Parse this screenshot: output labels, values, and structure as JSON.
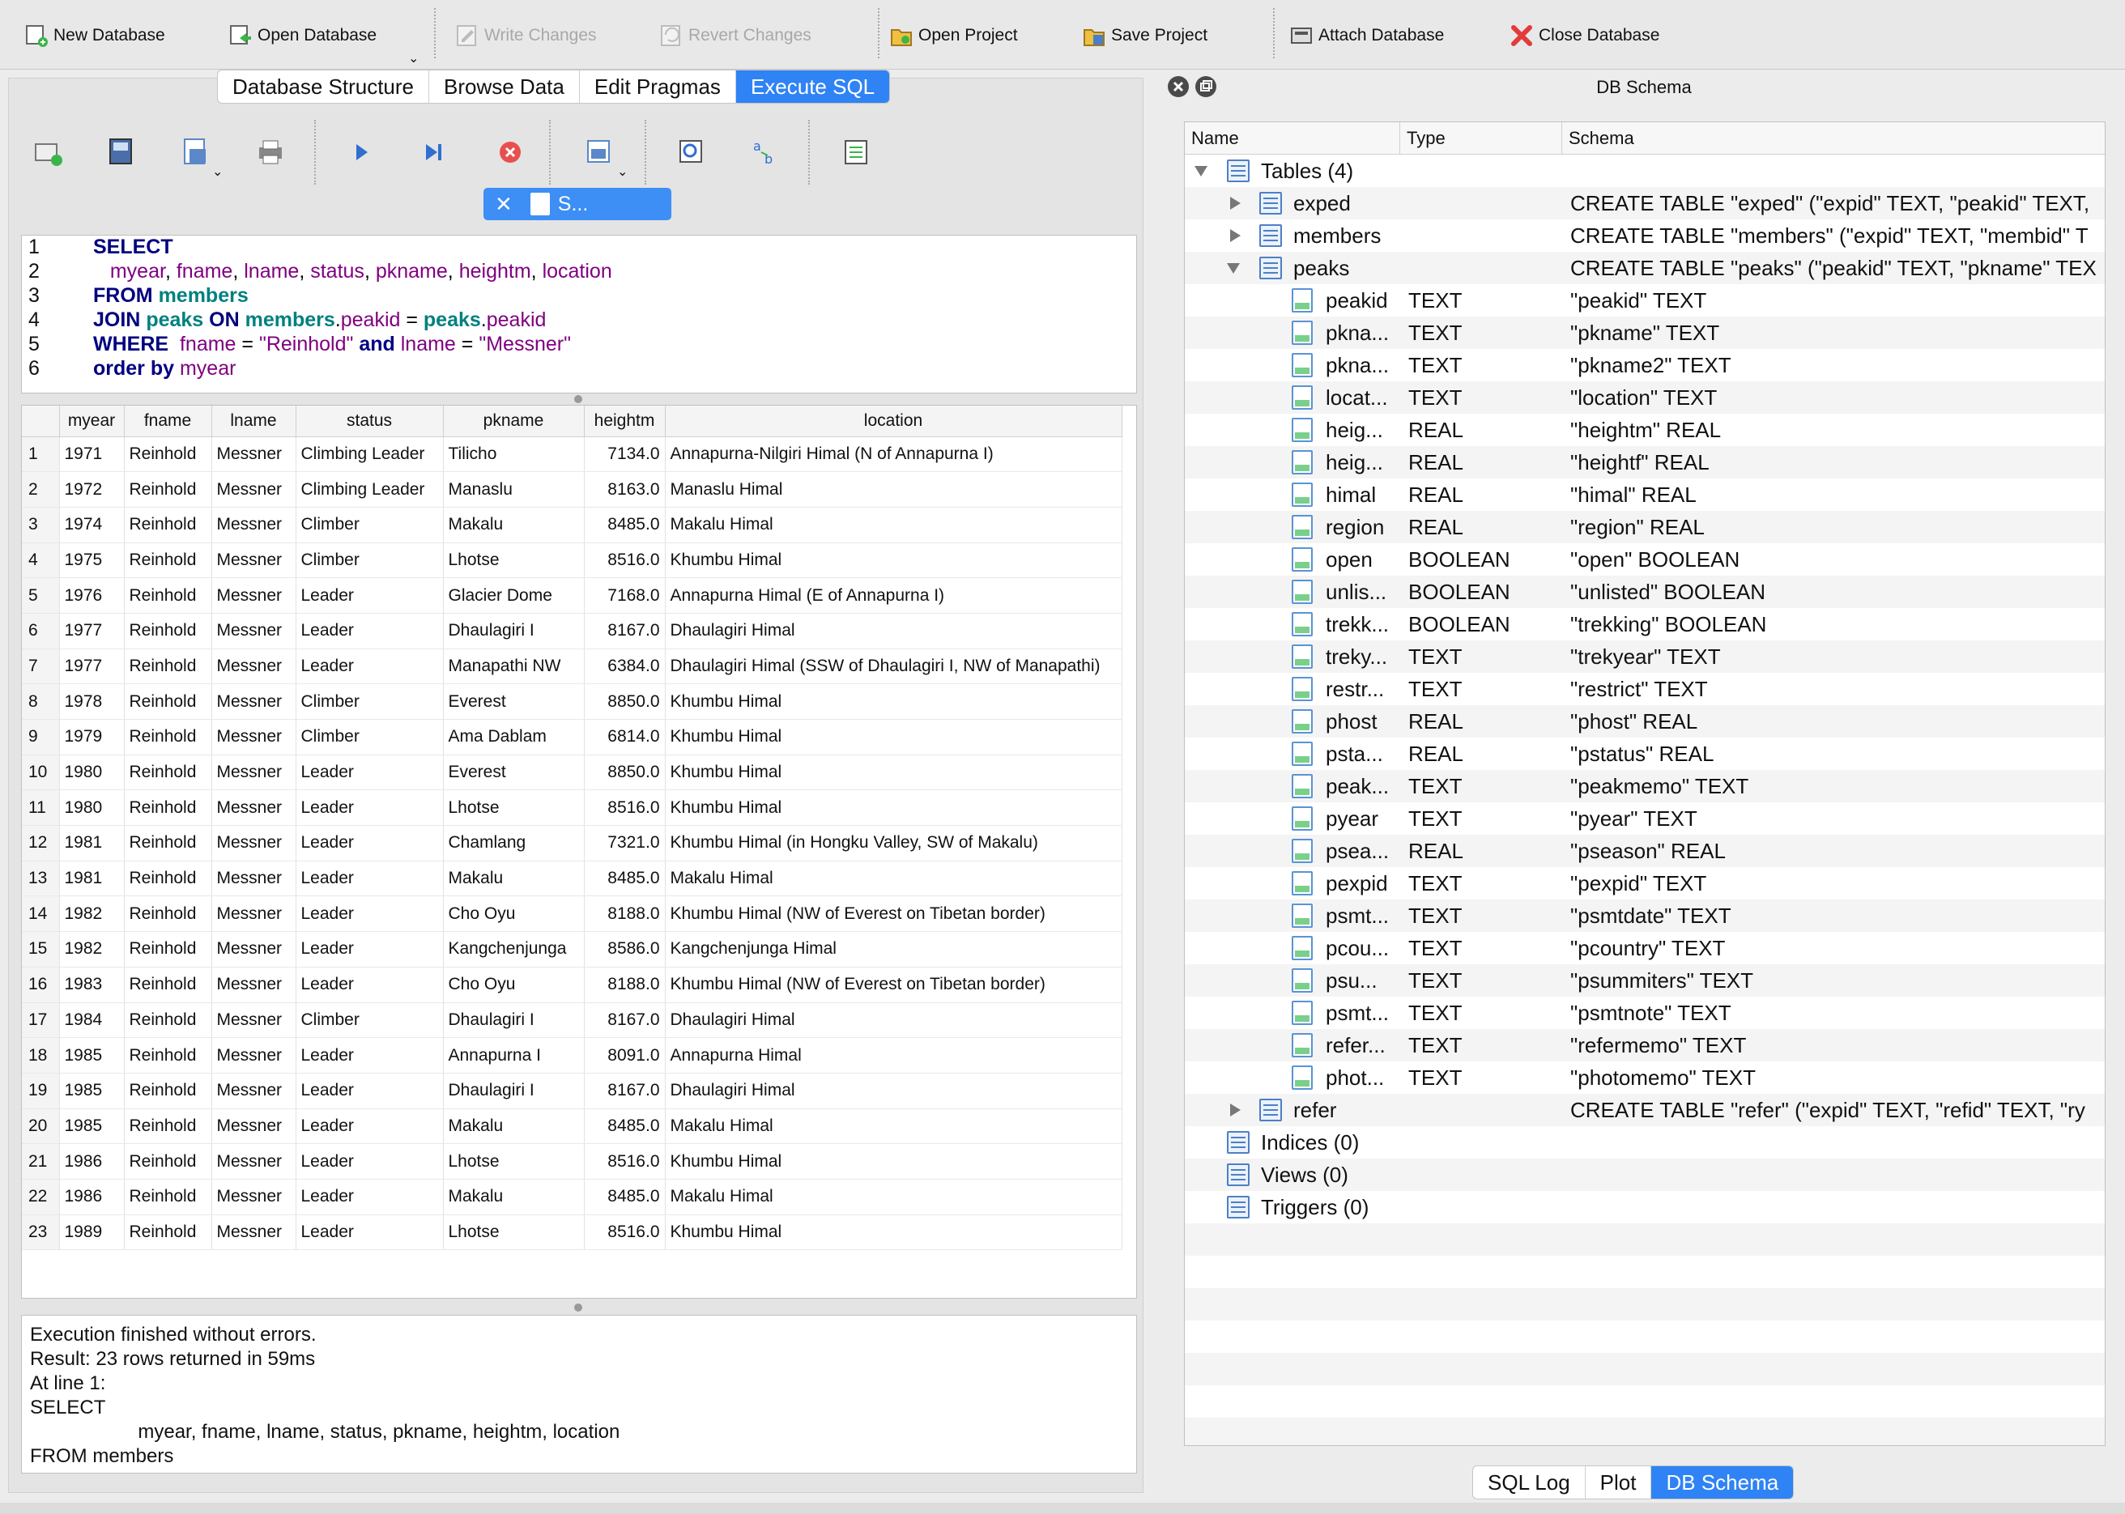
{
  "toolbar": {
    "new_db": "New Database",
    "open_db": "Open Database",
    "write": "Write Changes",
    "revert": "Revert Changes",
    "open_proj": "Open Project",
    "save_proj": "Save Project",
    "attach": "Attach Database",
    "close": "Close Database"
  },
  "tabs": [
    "Database Structure",
    "Browse Data",
    "Edit Pragmas",
    "Execute SQL"
  ],
  "editor_tab": "S...",
  "sql_lines": [
    "1",
    "2",
    "3",
    "4",
    "5",
    "6"
  ],
  "sql": {
    "l1": "SELECT",
    "l2a": "myear",
    "l2b": "fname",
    "l2c": "lname",
    "l2d": "status",
    "l2e": "pkname",
    "l2f": "heightm",
    "l2g": "location",
    "l3a": "FROM",
    "l3b": "members",
    "l4a": "JOIN",
    "l4b": "peaks",
    "l4c": "ON",
    "l4d": "members",
    "l4e": "peakid",
    "l4f": "peaks",
    "l4g": "peakid",
    "l5a": "WHERE",
    "l5b": "fname",
    "l5c": "\"Reinhold\"",
    "l5d": "and",
    "l5e": "lname",
    "l5f": "\"Messner\"",
    "l6a": "order by",
    "l6b": "myear"
  },
  "results": {
    "columns": [
      "myear",
      "fname",
      "lname",
      "status",
      "pkname",
      "heightm",
      "location"
    ],
    "rows": [
      [
        "1",
        "1971",
        "Reinhold",
        "Messner",
        "Climbing Leader",
        "Tilicho",
        "7134.0",
        "Annapurna-Nilgiri Himal (N of Annapurna I)"
      ],
      [
        "2",
        "1972",
        "Reinhold",
        "Messner",
        "Climbing Leader",
        "Manaslu",
        "8163.0",
        "Manaslu Himal"
      ],
      [
        "3",
        "1974",
        "Reinhold",
        "Messner",
        "Climber",
        "Makalu",
        "8485.0",
        "Makalu Himal"
      ],
      [
        "4",
        "1975",
        "Reinhold",
        "Messner",
        "Climber",
        "Lhotse",
        "8516.0",
        "Khumbu Himal"
      ],
      [
        "5",
        "1976",
        "Reinhold",
        "Messner",
        "Leader",
        "Glacier Dome",
        "7168.0",
        "Annapurna Himal (E of Annapurna I)"
      ],
      [
        "6",
        "1977",
        "Reinhold",
        "Messner",
        "Leader",
        "Dhaulagiri I",
        "8167.0",
        "Dhaulagiri Himal"
      ],
      [
        "7",
        "1977",
        "Reinhold",
        "Messner",
        "Leader",
        "Manapathi NW",
        "6384.0",
        "Dhaulagiri Himal (SSW of Dhaulagiri I, NW of Manapathi)"
      ],
      [
        "8",
        "1978",
        "Reinhold",
        "Messner",
        "Climber",
        "Everest",
        "8850.0",
        "Khumbu Himal"
      ],
      [
        "9",
        "1979",
        "Reinhold",
        "Messner",
        "Climber",
        "Ama Dablam",
        "6814.0",
        "Khumbu Himal"
      ],
      [
        "10",
        "1980",
        "Reinhold",
        "Messner",
        "Leader",
        "Everest",
        "8850.0",
        "Khumbu Himal"
      ],
      [
        "11",
        "1980",
        "Reinhold",
        "Messner",
        "Leader",
        "Lhotse",
        "8516.0",
        "Khumbu Himal"
      ],
      [
        "12",
        "1981",
        "Reinhold",
        "Messner",
        "Leader",
        "Chamlang",
        "7321.0",
        "Khumbu Himal (in Hongku Valley, SW of Makalu)"
      ],
      [
        "13",
        "1981",
        "Reinhold",
        "Messner",
        "Leader",
        "Makalu",
        "8485.0",
        "Makalu Himal"
      ],
      [
        "14",
        "1982",
        "Reinhold",
        "Messner",
        "Leader",
        "Cho Oyu",
        "8188.0",
        "Khumbu Himal (NW of Everest on Tibetan border)"
      ],
      [
        "15",
        "1982",
        "Reinhold",
        "Messner",
        "Leader",
        "Kangchenjunga",
        "8586.0",
        "Kangchenjunga Himal"
      ],
      [
        "16",
        "1983",
        "Reinhold",
        "Messner",
        "Leader",
        "Cho Oyu",
        "8188.0",
        "Khumbu Himal (NW of Everest on Tibetan border)"
      ],
      [
        "17",
        "1984",
        "Reinhold",
        "Messner",
        "Climber",
        "Dhaulagiri I",
        "8167.0",
        "Dhaulagiri Himal"
      ],
      [
        "18",
        "1985",
        "Reinhold",
        "Messner",
        "Leader",
        "Annapurna I",
        "8091.0",
        "Annapurna Himal"
      ],
      [
        "19",
        "1985",
        "Reinhold",
        "Messner",
        "Leader",
        "Dhaulagiri I",
        "8167.0",
        "Dhaulagiri Himal"
      ],
      [
        "20",
        "1985",
        "Reinhold",
        "Messner",
        "Leader",
        "Makalu",
        "8485.0",
        "Makalu Himal"
      ],
      [
        "21",
        "1986",
        "Reinhold",
        "Messner",
        "Leader",
        "Lhotse",
        "8516.0",
        "Khumbu Himal"
      ],
      [
        "22",
        "1986",
        "Reinhold",
        "Messner",
        "Leader",
        "Makalu",
        "8485.0",
        "Makalu Himal"
      ],
      [
        "23",
        "1989",
        "Reinhold",
        "Messner",
        "Leader",
        "Lhotse",
        "8516.0",
        "Khumbu Himal"
      ]
    ]
  },
  "messages": [
    "Execution finished without errors.",
    "Result: 23 rows returned in 59ms",
    "At line 1:",
    "SELECT",
    "                    myear, fname, lname, status, pkname, heightm, location",
    "FROM members"
  ],
  "schema": {
    "title": "DB Schema",
    "headers": [
      "Name",
      "Type",
      "Schema"
    ],
    "tables_label": "Tables (4)",
    "tables": [
      {
        "name": "exped",
        "schema": "CREATE TABLE \"exped\" (\"expid\" TEXT, \"peakid\" TEXT,"
      },
      {
        "name": "members",
        "schema": "CREATE TABLE \"members\" (\"expid\" TEXT, \"membid\" T"
      },
      {
        "name": "peaks",
        "schema": "CREATE TABLE \"peaks\" (\"peakid\" TEXT, \"pkname\" TEX"
      }
    ],
    "fields": [
      [
        "peakid",
        "TEXT",
        "\"peakid\" TEXT"
      ],
      [
        "pkna...",
        "TEXT",
        "\"pkname\" TEXT"
      ],
      [
        "pkna...",
        "TEXT",
        "\"pkname2\" TEXT"
      ],
      [
        "locat...",
        "TEXT",
        "\"location\" TEXT"
      ],
      [
        "heig...",
        "REAL",
        "\"heightm\" REAL"
      ],
      [
        "heig...",
        "REAL",
        "\"heightf\" REAL"
      ],
      [
        "himal",
        "REAL",
        "\"himal\" REAL"
      ],
      [
        "region",
        "REAL",
        "\"region\" REAL"
      ],
      [
        "open",
        "BOOLEAN",
        "\"open\" BOOLEAN"
      ],
      [
        "unlis...",
        "BOOLEAN",
        "\"unlisted\" BOOLEAN"
      ],
      [
        "trekk...",
        "BOOLEAN",
        "\"trekking\" BOOLEAN"
      ],
      [
        "treky...",
        "TEXT",
        "\"trekyear\" TEXT"
      ],
      [
        "restr...",
        "TEXT",
        "\"restrict\" TEXT"
      ],
      [
        "phost",
        "REAL",
        "\"phost\" REAL"
      ],
      [
        "psta...",
        "REAL",
        "\"pstatus\" REAL"
      ],
      [
        "peak...",
        "TEXT",
        "\"peakmemo\" TEXT"
      ],
      [
        "pyear",
        "TEXT",
        "\"pyear\" TEXT"
      ],
      [
        "psea...",
        "REAL",
        "\"pseason\" REAL"
      ],
      [
        "pexpid",
        "TEXT",
        "\"pexpid\" TEXT"
      ],
      [
        "psmt...",
        "TEXT",
        "\"psmtdate\" TEXT"
      ],
      [
        "pcou...",
        "TEXT",
        "\"pcountry\" TEXT"
      ],
      [
        "psu...",
        "TEXT",
        "\"psummiters\" TEXT"
      ],
      [
        "psmt...",
        "TEXT",
        "\"psmtnote\" TEXT"
      ],
      [
        "refer...",
        "TEXT",
        "\"refermemo\" TEXT"
      ],
      [
        "phot...",
        "TEXT",
        "\"photomemo\" TEXT"
      ]
    ],
    "refer": {
      "name": "refer",
      "schema": "CREATE TABLE \"refer\" (\"expid\" TEXT, \"refid\" TEXT, \"ry"
    },
    "indices": "Indices (0)",
    "views": "Views (0)",
    "triggers": "Triggers (0)"
  },
  "bottom_tabs": [
    "SQL Log",
    "Plot",
    "DB Schema"
  ]
}
